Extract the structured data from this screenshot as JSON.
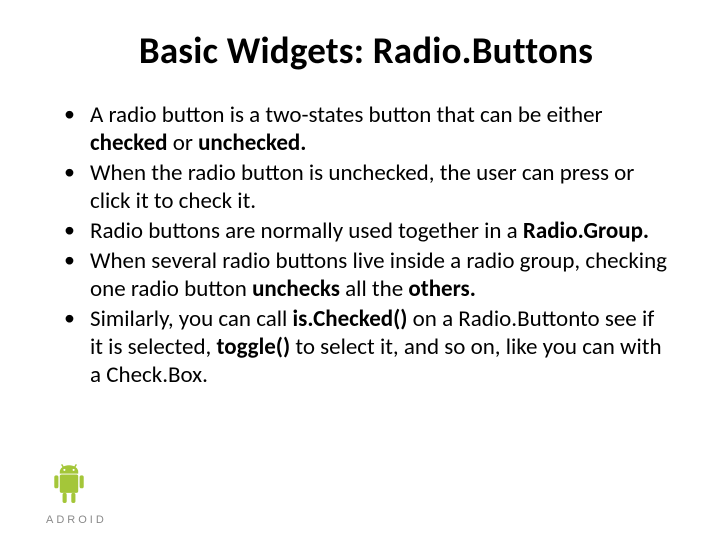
{
  "title": "Basic Widgets: Radio.Buttons",
  "bullets": {
    "b1p1": "A radio button is a two-states button that can be either ",
    "b1b1": "checked",
    "b1p2": " or ",
    "b1b2": "unchecked.",
    "b2": "When the radio button is unchecked, the user can press or click it to check it.",
    "b3p1": "Radio buttons are normally used together in a ",
    "b3b1": "Radio.Group",
    "b3p2": ".",
    "b4p1": "When several radio buttons live inside a radio group, checking one radio button ",
    "b4b1": "unchecks",
    "b4p2": " all the ",
    "b4b2": "others.",
    "b5p1": "Similarly, you can call ",
    "b5b1": "is.Checked()",
    "b5p2": " on a Radio.Buttonto see if it is selected, ",
    "b5b2": "toggle()",
    "b5p3": " to select it, and so on, like you can with a Check.Box."
  },
  "wordmark": "ADROID"
}
